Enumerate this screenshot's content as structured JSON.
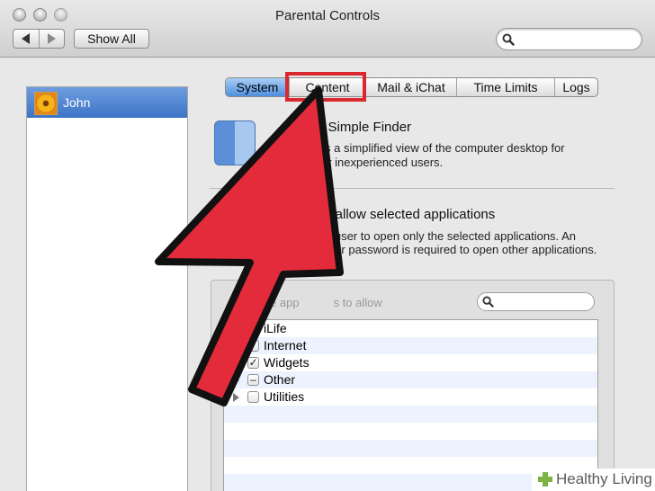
{
  "window": {
    "title": "Parental Controls"
  },
  "toolbar": {
    "show_all_label": "Show All",
    "search_value": ""
  },
  "sidebar": {
    "users": [
      {
        "name": "John",
        "selected": true
      }
    ]
  },
  "tabs": [
    {
      "label": "System",
      "selected": true
    },
    {
      "label": "Content",
      "selected": false
    },
    {
      "label": "Mail & iChat",
      "selected": false
    },
    {
      "label": "Time Limits",
      "selected": false
    },
    {
      "label": "Logs",
      "selected": false
    }
  ],
  "options": {
    "simple_finder": {
      "title": "e Simple Finder",
      "desc_line1": "s a simplified view of the computer desktop for",
      "desc_line2": "or inexperienced users."
    },
    "allow_apps": {
      "title": "y allow selected applications",
      "desc_line1": "e user to open only the selected applications. An",
      "desc_line2": "rator password is required to open other applications."
    }
  },
  "apps": {
    "search_placeholder_visible": "e app",
    "search_placeholder_visible2": "s to allow",
    "search_value": "",
    "items": [
      {
        "label": "iLife",
        "check": "",
        "disclosure": false
      },
      {
        "label": "Internet",
        "check": "",
        "disclosure": false
      },
      {
        "label": "Widgets",
        "check": "✓",
        "disclosure": false
      },
      {
        "label": "Other",
        "check": "–",
        "disclosure": true
      },
      {
        "label": "Utilities",
        "check": "",
        "disclosure": true
      }
    ]
  },
  "colors": {
    "selection_blue": "#4f8fdd",
    "highlight_red": "#d9282f",
    "arrow_red": "#e32b3b"
  },
  "watermark": {
    "text": "Healthy Living"
  }
}
